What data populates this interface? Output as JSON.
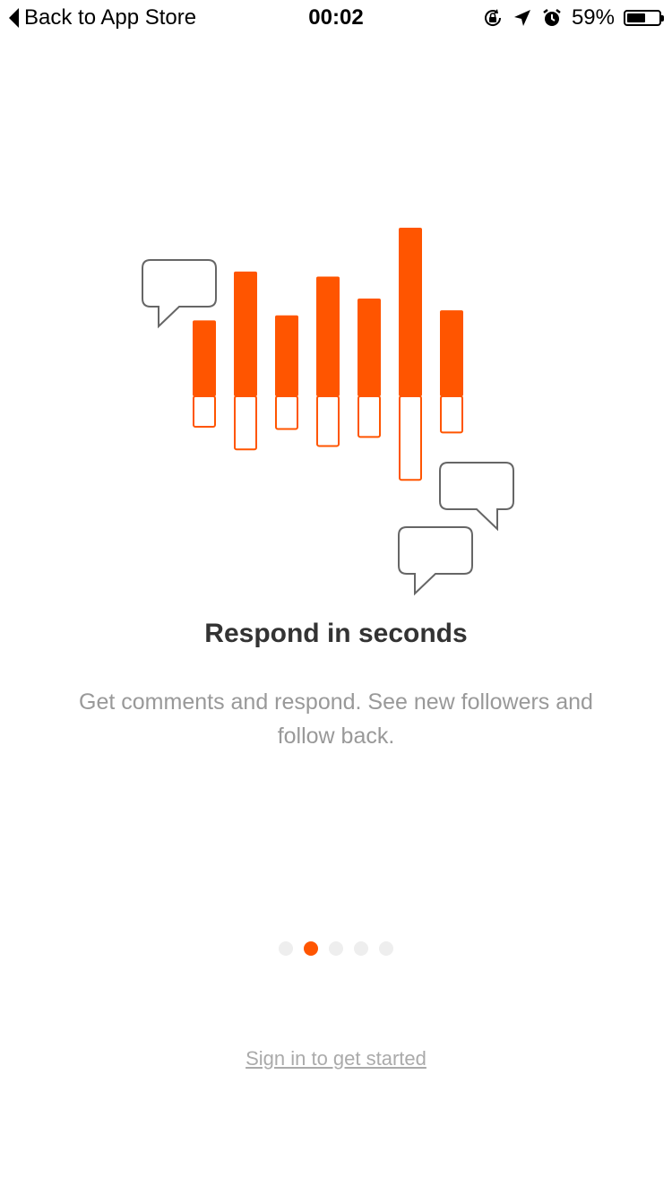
{
  "status_bar": {
    "back_label": "Back to App Store",
    "time": "00:02",
    "battery_percent": "59%",
    "battery_level": 0.59,
    "icons": [
      "rotation-lock-icon",
      "location-arrow-icon",
      "alarm-icon",
      "battery-icon"
    ]
  },
  "onboarding": {
    "title": "Respond in seconds",
    "description": "Get comments and respond. See new followers and follow back.",
    "pager": {
      "total": 5,
      "active_index": 1
    },
    "signin_label": "Sign in to get started"
  },
  "colors": {
    "accent": "#ff5500",
    "title": "#333333",
    "description": "#999999",
    "bubble_stroke": "#666666",
    "dot_inactive": "#eeeeee",
    "link": "#aaaaaa"
  },
  "illustration": {
    "bars": [
      {
        "upper": 0.45,
        "lower": 0.27
      },
      {
        "upper": 0.74,
        "lower": 0.47
      },
      {
        "upper": 0.48,
        "lower": 0.29
      },
      {
        "upper": 0.71,
        "lower": 0.44
      },
      {
        "upper": 0.58,
        "lower": 0.36
      },
      {
        "upper": 1.0,
        "lower": 0.74
      },
      {
        "upper": 0.51,
        "lower": 0.32
      }
    ]
  }
}
